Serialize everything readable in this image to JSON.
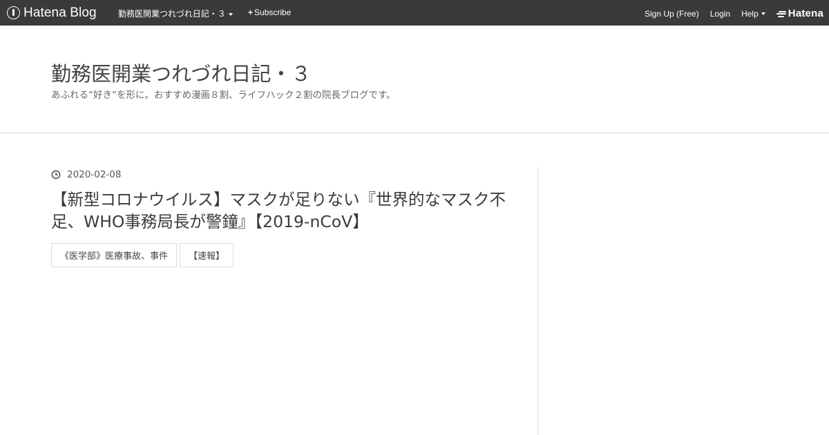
{
  "topbar": {
    "logo_text": "Hatena Blog",
    "blog_name": "勤務医開業つれづれ日記・３",
    "subscribe": "Subscribe",
    "signup": "Sign Up (Free)",
    "login": "Login",
    "help": "Help",
    "hatena": "Hatena",
    "bg_color": "#3a3a3a"
  },
  "header": {
    "title": "勤務医開業つれづれ日記・３",
    "description": "あふれる”好き”を形に。おすすめ漫画８割、ライフハック２割の院長ブログです。"
  },
  "entry": {
    "date": "2020-02-08",
    "title": "【新型コロナウイルス】マスクが足りない『世界的なマスク不足、WHO事務局長が警鐘』【2019-nCoV】",
    "categories": [
      "《医学部》医療事故、事件",
      "【速報】"
    ]
  }
}
